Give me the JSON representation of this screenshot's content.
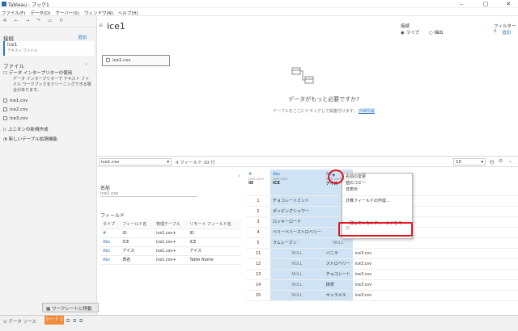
{
  "window": {
    "title": "Tableau - ブック1",
    "minimize": "–",
    "maximize": "▢",
    "close": "✕"
  },
  "menu": [
    "ファイル(F)",
    "データ(D)",
    "サーバー(S)",
    "ウィンドウ(N)",
    "ヘルプ(H)"
  ],
  "datasource": {
    "name": "ice1"
  },
  "connection": {
    "label": "接続",
    "live": "ライブ",
    "extract": "抽出"
  },
  "filter": {
    "label": "フィルター",
    "count": "0",
    "add": "追加"
  },
  "left": {
    "conn_header": "接続",
    "conn_add": "追加",
    "conn_name": "ice1",
    "conn_type": "テキスト ファイル",
    "files_header": "ファイル",
    "interpreter": "データ インタープリターの使用",
    "interpreter_desc": "データ インタープリターで テキスト ファイル ワークブックをクリーニングできる場合があります。",
    "files": [
      "ice1.csv",
      "ice2.csv",
      "ice3.csv"
    ],
    "union": "ユニオンの新規作成",
    "newtable": "新しいテーブル拡張機能"
  },
  "canvas": {
    "table_chip": "ice1.csv",
    "prompt_title": "データがもっと必要ですか?",
    "prompt_desc": "テーブルをここにドラッグして関連付けます。",
    "prompt_link": "詳細情報"
  },
  "gridbar": {
    "table": "ice1.csv",
    "fields_info": "4 フィールド 10 行",
    "rows": "10",
    "rows_unit": "行"
  },
  "meta": {
    "name_label": "名前",
    "name_value": "ice1.csv",
    "fields_label": "フィールド",
    "headers": [
      "タイプ",
      "フィールド名",
      "物理テーブル",
      "リモート フィールド名"
    ],
    "rows": [
      [
        "#",
        "ID",
        "ice1.csv+",
        "ID"
      ],
      [
        "Abc",
        "ICE",
        "ice1.csv+",
        "ICE"
      ],
      [
        "Abc",
        "アイス",
        "ice1.csv+",
        "アイス"
      ],
      [
        "Abc",
        "表名",
        "ice1.csv+",
        "Table Name"
      ]
    ]
  },
  "grid": {
    "columns": [
      {
        "type": "#",
        "source": "ice1.csv+",
        "name": "ID"
      },
      {
        "type": "Abc",
        "source": "ice1.csv+",
        "name": "ICE"
      },
      {
        "type": "Abc",
        "source": "ice1.csv+",
        "name": "アイス"
      },
      {
        "type": "",
        "source": "",
        "name": ""
      }
    ],
    "rows": [
      [
        "1",
        "チョコレートミント",
        "",
        ""
      ],
      [
        "2",
        "ポッピングシャワー",
        "",
        ""
      ],
      [
        "3",
        "ロッキーロード",
        "",
        ""
      ],
      [
        "4",
        "ベリーベリーストロベリー",
        "",
        ""
      ],
      [
        "5",
        "ラムレーズン",
        "NULL",
        ""
      ],
      [
        "11",
        "NULL",
        "バニラ",
        "ice3.csv"
      ],
      [
        "12",
        "NULL",
        "ストロベリー",
        "ice3.csv"
      ],
      [
        "13",
        "NULL",
        "チョコレート",
        "ice3.csv"
      ],
      [
        "14",
        "NULL",
        "抹茶",
        "ice3.csv"
      ],
      [
        "15",
        "NULL",
        "キャラメル",
        "ice3.csv"
      ]
    ]
  },
  "context_menu": [
    "名前の変更",
    "値のコピー",
    "非表示",
    "計算フィールドの作成...",
    "一致していないフィールドをマージ"
  ],
  "bottom": {
    "go_worksheet": "ワークシートに移動",
    "datasource_tab": "データ ソース",
    "sheet_tab": "シート 1"
  },
  "colors": {
    "accent": "#2b78c5",
    "highlight": "#e0141e",
    "sheet": "#f28b3c",
    "selected": "#cfe3f4"
  }
}
